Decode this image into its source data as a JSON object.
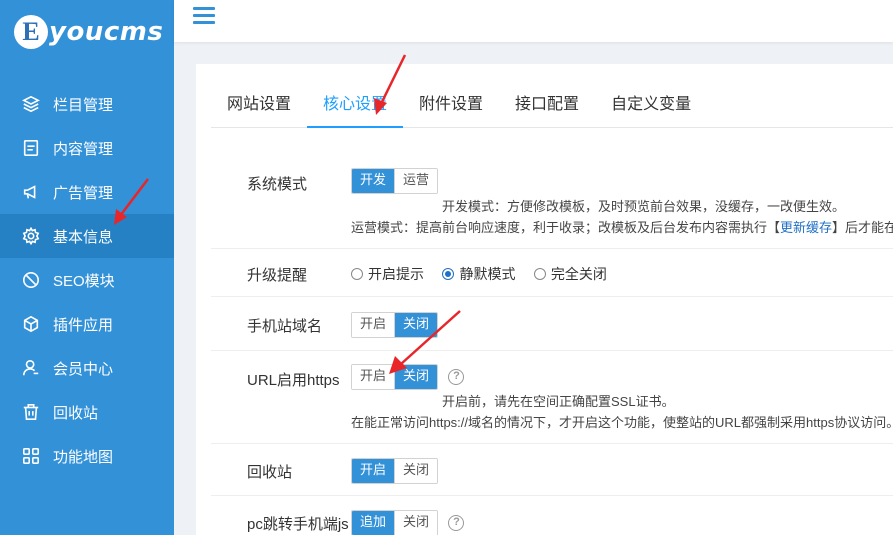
{
  "logo": {
    "letter": "E",
    "text": "youcms"
  },
  "sidebar": {
    "items": [
      {
        "label": "栏目管理",
        "icon": "layers-icon"
      },
      {
        "label": "内容管理",
        "icon": "document-icon"
      },
      {
        "label": "广告管理",
        "icon": "megaphone-icon"
      },
      {
        "label": "基本信息",
        "icon": "gear-icon",
        "active": true
      },
      {
        "label": "SEO模块",
        "icon": "seo-icon"
      },
      {
        "label": "插件应用",
        "icon": "cube-icon"
      },
      {
        "label": "会员中心",
        "icon": "user-icon"
      },
      {
        "label": "回收站",
        "icon": "trash-icon"
      },
      {
        "label": "功能地图",
        "icon": "grid-icon"
      }
    ]
  },
  "tabs": [
    {
      "label": "网站设置"
    },
    {
      "label": "核心设置",
      "active": true
    },
    {
      "label": "附件设置"
    },
    {
      "label": "接口配置"
    },
    {
      "label": "自定义变量"
    }
  ],
  "settings": {
    "system_mode": {
      "label": "系统模式",
      "options": [
        "开发",
        "运营"
      ],
      "selected": "开发",
      "note1": "开发模式：方便修改模板，及时预览前台效果，没缓存，一改便生效。",
      "note2_prefix": "运营模式：提高前台响应速度，利于收录；改模板及后台发布内容需执行【",
      "note2_link": "更新缓存",
      "note2_suffix": "】后才能在前"
    },
    "upgrade_notice": {
      "label": "升级提醒",
      "options": [
        "开启提示",
        "静默模式",
        "完全关闭"
      ],
      "selected": "静默模式"
    },
    "mobile_domain": {
      "label": "手机站域名",
      "options": [
        "开启",
        "关闭"
      ],
      "selected": "关闭"
    },
    "url_https": {
      "label": "URL启用https",
      "options": [
        "开启",
        "关闭"
      ],
      "selected": "关闭",
      "help": "?",
      "note1": "开启前，请先在空间正确配置SSL证书。",
      "note2": "在能正常访问https://域名的情况下，才开启这个功能，使整站的URL都强制采用https协议访问。"
    },
    "recycle_bin": {
      "label": "回收站",
      "options": [
        "开启",
        "关闭"
      ],
      "selected": "开启"
    },
    "pc_mobile_js": {
      "label": "pc跳转手机端js",
      "options": [
        "追加",
        "关闭"
      ],
      "selected": "追加",
      "help": "?"
    }
  },
  "colors": {
    "sidebar_bg": "#3391d8",
    "sidebar_active": "#2680c4",
    "accent": "#1e9fff",
    "arrow": "#e8262a"
  }
}
